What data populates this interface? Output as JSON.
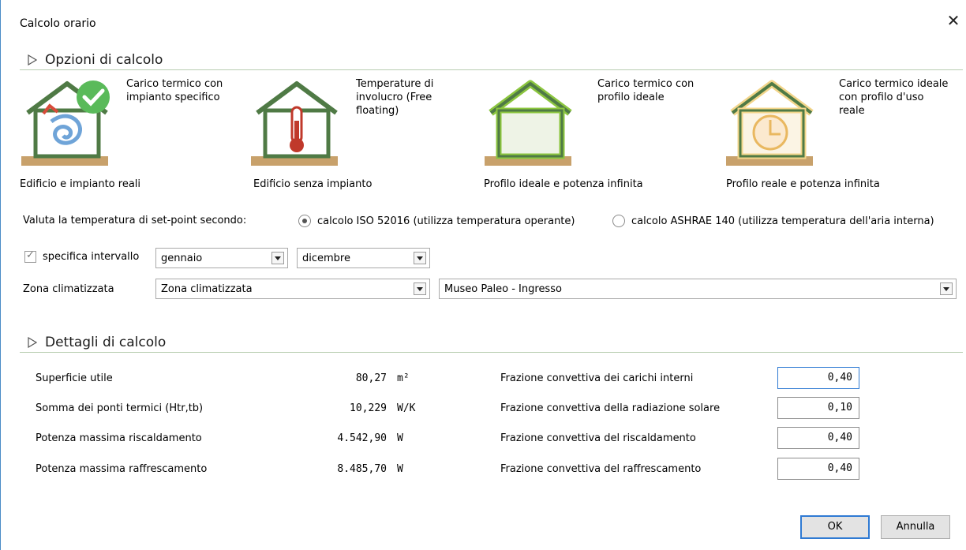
{
  "window": {
    "title": "Calcolo orario",
    "close_glyph": "✕"
  },
  "section1": {
    "title": "Opzioni di calcolo"
  },
  "options": [
    {
      "text": "Carico termico con impianto specifico",
      "caption": "Edificio e impianto reali",
      "icon": "house-heating-check-icon"
    },
    {
      "text": "Temperature di involucro (Free floating)",
      "caption": "Edificio senza impianto",
      "icon": "house-thermometer-icon"
    },
    {
      "text": "Carico termico con profilo ideale",
      "caption": "Profilo ideale e potenza infinita",
      "icon": "house-ideal-icon"
    },
    {
      "text": "Carico termico ideale con profilo d'uso reale",
      "caption": "Profilo reale e potenza infinita",
      "icon": "house-clock-icon"
    }
  ],
  "setpoint": {
    "label": "Valuta la temperatura di set-point secondo:",
    "radio_iso": "calcolo ISO 52016 (utilizza temperatura operante)",
    "radio_ashrae": "calcolo ASHRAE 140 (utilizza temperatura dell'aria interna)",
    "selected": "iso"
  },
  "interval": {
    "label": "specifica intervallo",
    "checked": true,
    "from": "gennaio",
    "to": "dicembre"
  },
  "zone": {
    "label": "Zona climatizzata",
    "type_value": "Zona climatizzata",
    "zone_value": "Museo Paleo - Ingresso"
  },
  "section2": {
    "title": "Dettagli di calcolo"
  },
  "details_left": [
    {
      "label": "Superficie utile",
      "value": "80,27",
      "unit": "m²"
    },
    {
      "label": "Somma dei ponti termici (Htr,tb)",
      "value": "10,229",
      "unit": "W/K"
    },
    {
      "label": "Potenza massima riscaldamento",
      "value": "4.542,90",
      "unit": "W"
    },
    {
      "label": "Potenza massima raffrescamento",
      "value": "8.485,70",
      "unit": "W"
    }
  ],
  "details_right": [
    {
      "label": "Frazione convettiva dei carichi interni",
      "value": "0,40"
    },
    {
      "label": "Frazione convettiva della radiazione solare",
      "value": "0,10"
    },
    {
      "label": "Frazione convettiva del riscaldamento",
      "value": "0,40"
    },
    {
      "label": "Frazione convettiva del raffrescamento",
      "value": "0,40"
    }
  ],
  "buttons": {
    "ok": "OK",
    "cancel": "Annulla"
  },
  "colors": {
    "accent": "#2f7ad3",
    "house_green": "#4f7a45",
    "ideal_green": "#8cc63f",
    "orange": "#e9b860"
  }
}
